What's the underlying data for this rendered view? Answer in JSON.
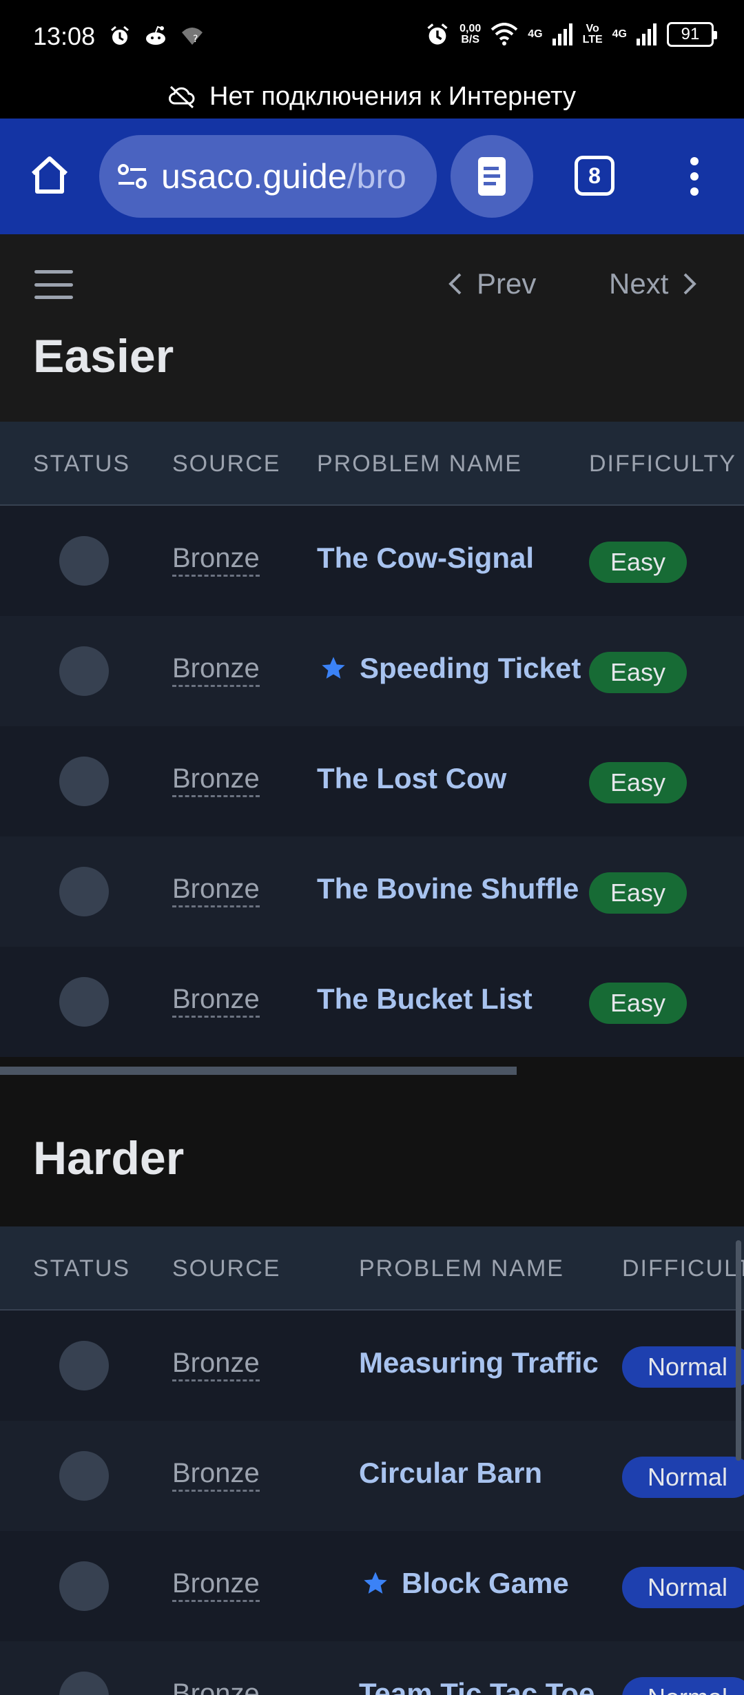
{
  "status_bar": {
    "time": "13:08",
    "net_speed_value": "0,00",
    "net_speed_unit": "B/S",
    "net1": "4G",
    "volte_top": "Vo",
    "volte_bottom": "LTE",
    "net2": "4G",
    "battery": "91"
  },
  "offline_banner": {
    "text": "Нет подключения к Интернету"
  },
  "browser": {
    "url_host": "usaco.guide",
    "url_path": "/bro",
    "tab_count": "8"
  },
  "nav": {
    "prev": "Prev",
    "next": "Next"
  },
  "sections": [
    {
      "title": "Easier",
      "columns": [
        "STATUS",
        "SOURCE",
        "PROBLEM NAME",
        "DIFFICULTY"
      ],
      "rows": [
        {
          "source": "Bronze",
          "name": "The Cow-Signal",
          "starred": false,
          "difficulty": "Easy"
        },
        {
          "source": "Bronze",
          "name": "Speeding Ticket",
          "starred": true,
          "difficulty": "Easy"
        },
        {
          "source": "Bronze",
          "name": "The Lost Cow",
          "starred": false,
          "difficulty": "Easy"
        },
        {
          "source": "Bronze",
          "name": "The Bovine Shuffle",
          "starred": false,
          "difficulty": "Easy"
        },
        {
          "source": "Bronze",
          "name": "The Bucket List",
          "starred": false,
          "difficulty": "Easy"
        }
      ]
    },
    {
      "title": "Harder",
      "columns": [
        "STATUS",
        "SOURCE",
        "PROBLEM NAME",
        "DIFFICULTY"
      ],
      "rows": [
        {
          "source": "Bronze",
          "name": "Measuring Traffic",
          "starred": false,
          "difficulty": "Normal"
        },
        {
          "source": "Bronze",
          "name": "Circular Barn",
          "starred": false,
          "difficulty": "Normal"
        },
        {
          "source": "Bronze",
          "name": "Block Game",
          "starred": true,
          "difficulty": "Normal"
        },
        {
          "source": "Bronze",
          "name": "Team Tic Tac Toe",
          "starred": false,
          "difficulty": "Normal"
        }
      ]
    }
  ],
  "colors": {
    "toolbar": "#1434a4",
    "easy_badge": "#176b35",
    "normal_badge": "#1e40af",
    "problem_link": "#a8c3ef",
    "star": "#3b82f6"
  }
}
